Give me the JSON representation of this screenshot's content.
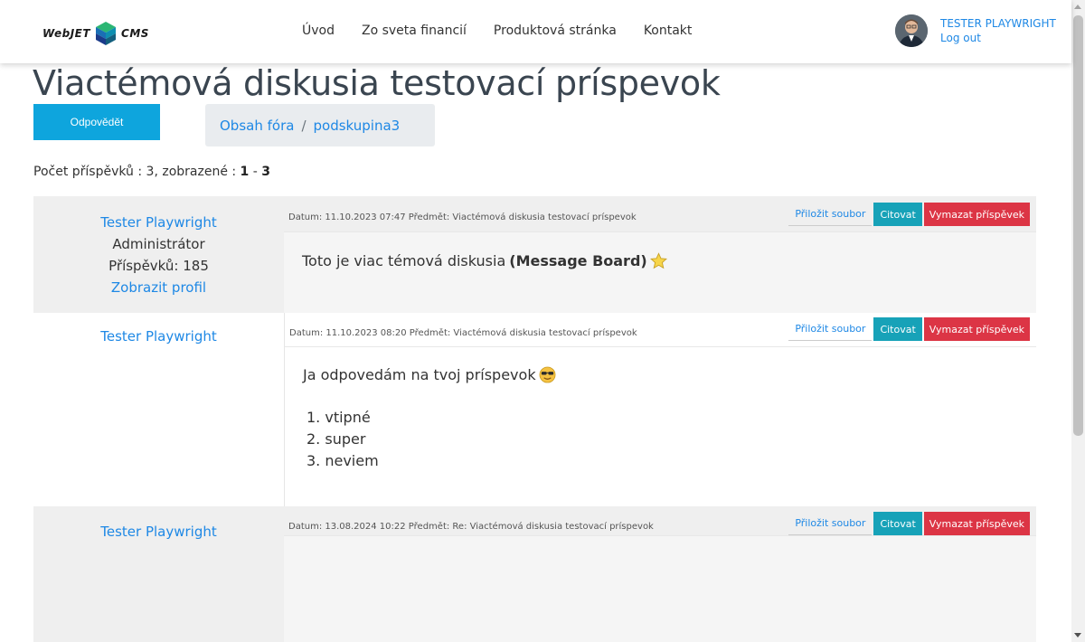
{
  "header": {
    "logo_left": "WebJET",
    "logo_right": "CMS",
    "nav": [
      "Úvod",
      "Zo sveta financií",
      "Produktová stránka",
      "Kontakt"
    ],
    "user_name": "TESTER PLAYWRIGHT",
    "logout": "Log out"
  },
  "page": {
    "title": "Viactémová diskusia testovací príspevok",
    "reply_button": "Odpovědět",
    "breadcrumb": [
      "Obsah fóra",
      "podskupina3"
    ],
    "breadcrumb_sep": "/",
    "count_prefix": "Počet příspěvků : 3, zobrazené : ",
    "count_from": "1",
    "count_dash": " - ",
    "count_to": "3"
  },
  "actions": {
    "attach": "Přiložit soubor",
    "cite": "Citovat",
    "delete": "Vymazat příspěvek"
  },
  "posts": [
    {
      "author": "Tester Playwright",
      "role": "Administrátor",
      "post_count": "Příspěvků: 185",
      "profile": "Zobrazit profil",
      "meta": "Datum: 11.10.2023 07:47 Předmět: Viactémová diskusia testovací príspevok",
      "text": "Toto je viac témová diskusia",
      "bold": "(Message Board)",
      "emoji": "star-icon"
    },
    {
      "author": "Tester Playwright",
      "meta": "Datum: 11.10.2023 08:20 Předmět: Viactémová diskusia testovací príspevok",
      "text": "Ja odpovedám na tvoj príspevok",
      "emoji": "cool-face-icon",
      "list": [
        "1. vtipné",
        "2. super",
        "3. neviem"
      ]
    },
    {
      "author": "Tester Playwright",
      "meta": "Datum: 13.08.2024 10:22 Předmět: Re: Viactémová diskusia testovací príspevok"
    }
  ]
}
